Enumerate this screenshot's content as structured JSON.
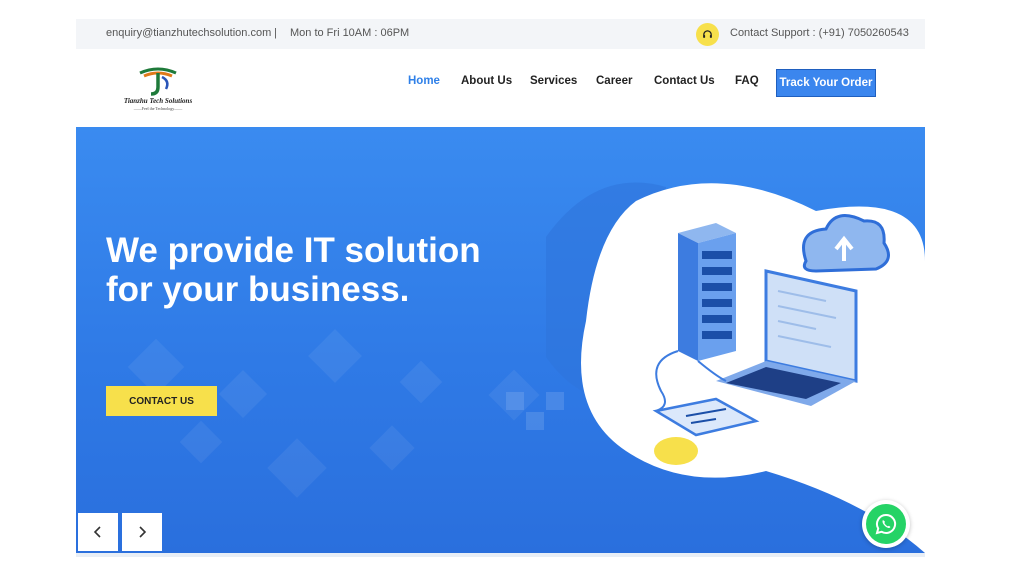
{
  "topbar": {
    "email": "enquiry@tianzhutechsolution.com",
    "separator": "|",
    "hours": "Mon to Fri 10AM : 06PM",
    "support": "Contact Support : (+91) 7050260543",
    "support_icon": "headset-icon"
  },
  "logo": {
    "name": "Tianzhu Tech Solutions",
    "tagline": "——Feel the Technology——"
  },
  "nav": {
    "items": [
      "Home",
      "About Us",
      "Services",
      "Career",
      "Contact Us",
      "FAQ"
    ],
    "active": "Home",
    "track_order": "Track Your Order"
  },
  "hero": {
    "headline_line1": "We provide IT solution",
    "headline_line2": "for your business.",
    "cta": "CONTACT US",
    "prev_icon": "chevron-left-icon",
    "next_icon": "chevron-right-icon"
  },
  "whatsapp": {
    "icon": "whatsapp-icon"
  },
  "colors": {
    "accent": "#2f80e8",
    "hero_blue": "#3a8bf0",
    "yellow": "#f7e04b",
    "whatsapp_green": "#25d366"
  }
}
